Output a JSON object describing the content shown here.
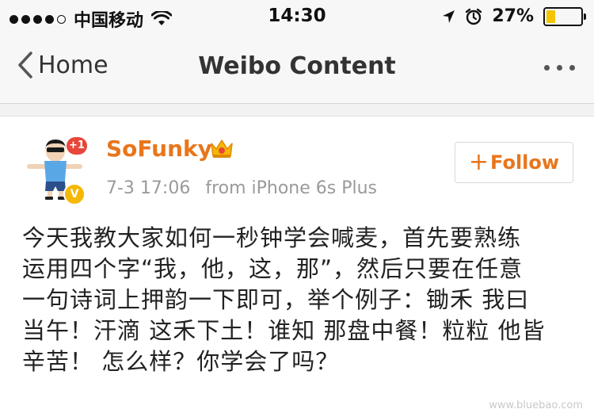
{
  "status_bar": {
    "carrier": "中国移动",
    "time": "14:30",
    "battery_percent": "27%",
    "battery_level": 0.27,
    "battery_color": "#f2c500",
    "signal_bars_filled": 4,
    "icons": [
      "wifi-icon",
      "location-arrow-icon",
      "alarm-icon",
      "battery-icon"
    ]
  },
  "nav": {
    "back_label": "Home",
    "title": "Weibo Content",
    "more_icon": "more-dots-icon"
  },
  "post": {
    "username": "SoFunky",
    "username_color": "#e8761c",
    "avatar_badge": "+1",
    "verified_badge": "V",
    "time": "7-3 17:06",
    "source": "from iPhone 6s Plus",
    "follow_plus": "+",
    "follow_label": "Follow",
    "lines": [
      "今天我教大家如何一秒钟学会喊麦，首先要熟练",
      "运用四个字“我，他，这，那”，然后只要在任意",
      "一句诗词上押韵一下即可，举个例子：锄禾 我曰",
      "当午！汗滴 这禾下土！谁知 那盘中餐！粒粒 他皆",
      "辛苦！ 怎么样？你学会了吗？"
    ]
  },
  "watermark": "www.bluebao.com"
}
